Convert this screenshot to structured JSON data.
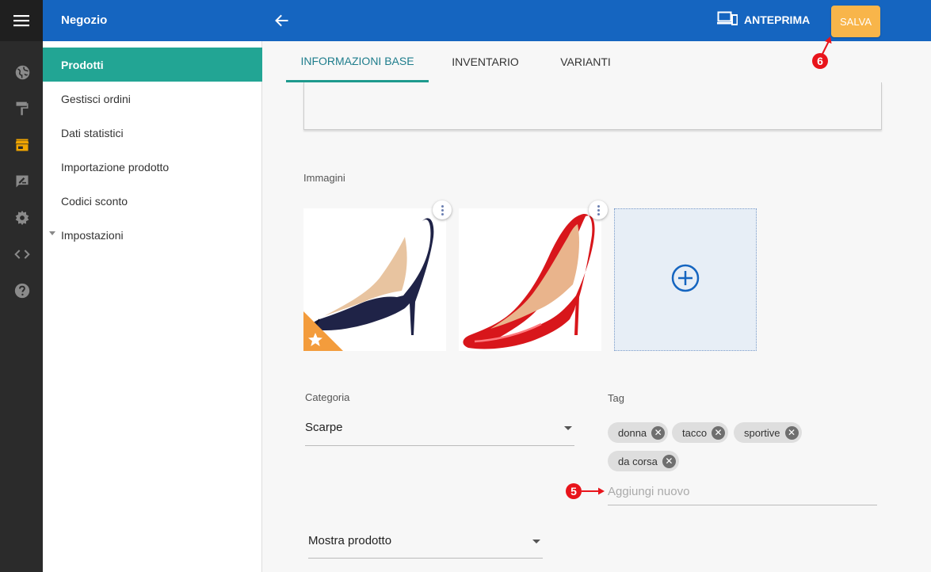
{
  "header": {
    "section_title": "Negozio",
    "preview_label": "ANTEPRIMA",
    "save_label": "SALVA"
  },
  "sidebar": {
    "items": [
      {
        "label": "Prodotti",
        "active": true
      },
      {
        "label": "Gestisci ordini"
      },
      {
        "label": "Dati statistici"
      },
      {
        "label": "Importazione prodotto"
      },
      {
        "label": "Codici sconto"
      },
      {
        "label": "Impostazioni",
        "collapsible": true
      }
    ]
  },
  "tabs": [
    {
      "label": "INFORMAZIONI BASE",
      "active": true
    },
    {
      "label": "INVENTARIO"
    },
    {
      "label": "VARIANTI"
    }
  ],
  "images": {
    "label": "Immagini",
    "items": [
      {
        "name": "navy-suede-pump",
        "color": "#1f2347",
        "featured": true
      },
      {
        "name": "red-patent-pump",
        "color": "#d8161b",
        "featured": false
      }
    ]
  },
  "category": {
    "label": "Categoria",
    "value": "Scarpe"
  },
  "tags": {
    "label": "Tag",
    "chips": [
      "donna",
      "tacco",
      "sportive",
      "da corsa"
    ],
    "placeholder": "Aggiungi nuovo"
  },
  "visibility": {
    "value": "Mostra prodotto"
  },
  "annotations": {
    "callout_5": "5",
    "callout_6": "6"
  },
  "colors": {
    "header": "#1565c0",
    "active_nav": "#22a594",
    "save_button": "#f8b54a",
    "callout": "#e8141b"
  }
}
